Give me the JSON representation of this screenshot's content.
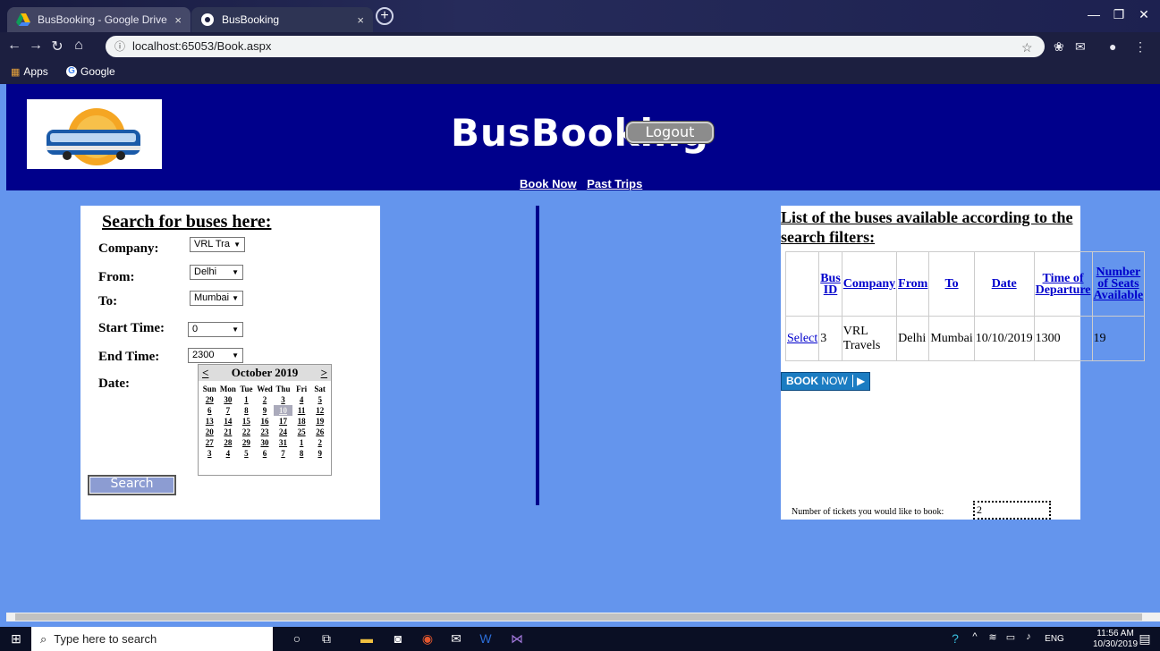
{
  "browser": {
    "tabs": [
      {
        "title": "BusBooking - Google Drive",
        "close": "×"
      },
      {
        "title": "BusBooking",
        "close": "×"
      }
    ],
    "new_tab": "+",
    "url": "localhost:65053/Book.aspx",
    "bookmarks": [
      {
        "label": "Apps"
      },
      {
        "label": "Google"
      }
    ]
  },
  "site": {
    "title": "BusBooking",
    "logout_label": "Logout",
    "nav": [
      "Book Now",
      "Past Trips"
    ]
  },
  "search": {
    "title": "Search for buses here:",
    "company_label": "Company:",
    "company_value": "VRL Tra",
    "from_label": "From:",
    "from_value": "Delhi",
    "to_label": "To:",
    "to_value": "Mumbai",
    "start_label": "Start Time:",
    "start_value": "0",
    "end_label": "End Time:",
    "end_value": "2300",
    "date_label": "Date:",
    "search_button": "Search",
    "calendar": {
      "prev": "<",
      "next": ">",
      "month": "October 2019",
      "days": [
        "Sun",
        "Mon",
        "Tue",
        "Wed",
        "Thu",
        "Fri",
        "Sat"
      ],
      "weeks": [
        [
          "29",
          "30",
          "1",
          "2",
          "3",
          "4",
          "5"
        ],
        [
          "6",
          "7",
          "8",
          "9",
          "10",
          "11",
          "12"
        ],
        [
          "13",
          "14",
          "15",
          "16",
          "17",
          "18",
          "19"
        ],
        [
          "20",
          "21",
          "22",
          "23",
          "24",
          "25",
          "26"
        ],
        [
          "27",
          "28",
          "29",
          "30",
          "31",
          "1",
          "2"
        ],
        [
          "3",
          "4",
          "5",
          "6",
          "7",
          "8",
          "9"
        ]
      ],
      "selected": "10"
    }
  },
  "results": {
    "title": "List of the buses available according to the search filters:",
    "headers": [
      "",
      "Bus ID",
      "Company",
      "From",
      "To",
      "Date",
      "Time of Departure",
      "Number of Seats Available"
    ],
    "rows": [
      [
        "Select",
        "3",
        "VRL Travels",
        "Delhi",
        "Mumbai",
        "10/10/2019",
        "1300",
        "19"
      ]
    ],
    "book_button_bold": "BOOK",
    "book_button_rest": "NOW",
    "tickets_label": "Number of tickets you would like to book:",
    "tickets_value": "2"
  },
  "taskbar": {
    "search_placeholder": "Type here to search",
    "lang": "ENG",
    "time": "11:56 AM",
    "date": "10/30/2019"
  }
}
